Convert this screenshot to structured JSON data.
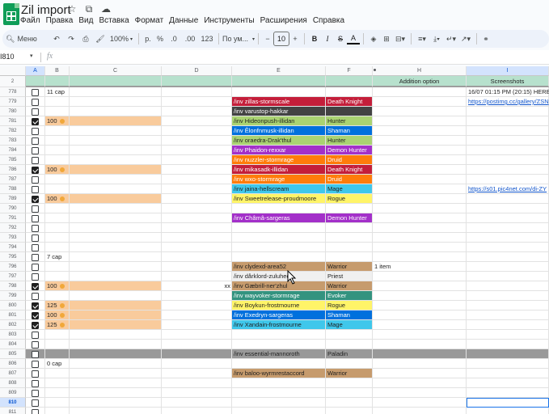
{
  "doc": {
    "title": "Zil import"
  },
  "title_icons": [
    "star-icon",
    "move-to-folder-icon",
    "cloud-status-icon"
  ],
  "menu": [
    "Файл",
    "Правка",
    "Вид",
    "Вставка",
    "Формат",
    "Данные",
    "Инструменты",
    "Расширения",
    "Справка"
  ],
  "toolbar": {
    "search_label": "Меню",
    "zoom": "100%",
    "currency": "р.",
    "percent": "%",
    "dec_decrease": ".0",
    "dec_increase": ".00",
    "number_format": "123",
    "font": "По ум...",
    "font_size": "10",
    "minus": "−",
    "plus": "+",
    "bold": "B",
    "italic": "I",
    "strike": "S",
    "text_color": "A"
  },
  "formula_bar": {
    "cell_ref": "I810",
    "fx": "fx"
  },
  "columns": [
    {
      "id": "A",
      "label": "A"
    },
    {
      "id": "B",
      "label": "B"
    },
    {
      "id": "C",
      "label": "C"
    },
    {
      "id": "D",
      "label": "D"
    },
    {
      "id": "E",
      "label": "E"
    },
    {
      "id": "F",
      "label": "F"
    },
    {
      "id": "H",
      "label": "H"
    },
    {
      "id": "I",
      "label": "I"
    }
  ],
  "header_row": {
    "rownum": "2",
    "H": "Addition option",
    "I": "Screenshots"
  },
  "colors": {
    "light_green_header": "#b7e1cd",
    "peach": "#f9cb9c",
    "gray_row": "#999999",
    "Death Knight": "#c41e3a",
    "Demon Hunter": "#a330c9",
    "Druid": "#ff7c0a",
    "Evoker": "#33937f",
    "Hunter": "#aad372",
    "Mage": "#3fc7eb",
    "Monk": "#00ff98",
    "Paladin": "#f48cba",
    "Priest": "#f0f0f0",
    "Rogue": "#fff468",
    "Shaman": "#0070dd",
    "Warlock": "#8788ee",
    "Warrior": "#c69b6d",
    "varustop": "#434343"
  },
  "rows": [
    {
      "n": "778",
      "checked": false,
      "B": "11 cap",
      "E": "",
      "F": "",
      "H": "",
      "I": "16/07 01:15 PM (20:15) HERE",
      "I_link": false,
      "peach": false,
      "cls": ""
    },
    {
      "n": "779",
      "checked": false,
      "B": "",
      "E": "/inv zillas-stormscale",
      "F": "Death Knight",
      "H": "",
      "I": "https://postimg.cc/gallery/ZSN",
      "I_link": true,
      "peach": false,
      "cls": "Death Knight"
    },
    {
      "n": "780",
      "checked": false,
      "B": "",
      "E": "/inv varustop-hakkar",
      "F": "",
      "H": "",
      "I": "",
      "I_link": false,
      "peach": false,
      "cls": "varustop"
    },
    {
      "n": "781",
      "checked": true,
      "B": "100",
      "gold": true,
      "E": "/inv Hideonpush-illidan",
      "F": "Hunter",
      "H": "",
      "I": "",
      "I_link": false,
      "peach": true,
      "cls": "Hunter"
    },
    {
      "n": "782",
      "checked": false,
      "B": "",
      "E": "/inv Êlonfnmusk-illidan",
      "F": "Shaman",
      "H": "",
      "I": "",
      "I_link": false,
      "peach": false,
      "cls": "Shaman"
    },
    {
      "n": "783",
      "checked": false,
      "B": "",
      "E": "/inv oraedra-Drak'thul",
      "F": "Hunter",
      "H": "",
      "I": "",
      "I_link": false,
      "peach": false,
      "cls": "Hunter"
    },
    {
      "n": "784",
      "checked": false,
      "B": "",
      "E": "/inv Phaidon-rexxar",
      "F": "Demon Hunter",
      "H": "",
      "I": "",
      "I_link": false,
      "peach": false,
      "cls": "Demon Hunter"
    },
    {
      "n": "785",
      "checked": false,
      "B": "",
      "E": "/inv nuzzler-stormrage",
      "F": "Druid",
      "H": "",
      "I": "",
      "I_link": false,
      "peach": false,
      "cls": "Druid"
    },
    {
      "n": "786",
      "checked": true,
      "B": "100",
      "gold": true,
      "E": "/inv mikasadk-illidan",
      "F": "Death Knight",
      "H": "",
      "I": "",
      "I_link": false,
      "peach": true,
      "cls": "Death Knight"
    },
    {
      "n": "787",
      "checked": false,
      "B": "",
      "E": "/inv wxo-stormrage",
      "F": "Druid",
      "H": "",
      "I": "",
      "I_link": false,
      "peach": false,
      "cls": "Druid"
    },
    {
      "n": "788",
      "checked": false,
      "B": "",
      "E": "/inv jaina-hellscream",
      "F": "Mage",
      "H": "",
      "I": "https://s01.pic4net.com/di-ZY",
      "I_link": true,
      "peach": false,
      "cls": "Mage"
    },
    {
      "n": "789",
      "checked": true,
      "B": "100",
      "gold": true,
      "E": "/inv Sweetrelease-proudmoore",
      "F": "Rogue",
      "H": "",
      "I": "",
      "I_link": false,
      "peach": true,
      "cls": "Rogue"
    },
    {
      "n": "790",
      "checked": false,
      "B": "",
      "E": "",
      "F": "",
      "H": "",
      "I": "",
      "I_link": false,
      "peach": false,
      "cls": ""
    },
    {
      "n": "791",
      "checked": false,
      "B": "",
      "E": "/inv Châmâ-sargeras",
      "F": "Demon Hunter",
      "H": "",
      "I": "",
      "I_link": false,
      "peach": false,
      "cls": "Demon Hunter"
    },
    {
      "n": "792",
      "checked": false,
      "B": "",
      "E": "",
      "F": "",
      "H": "",
      "I": "",
      "I_link": false,
      "peach": false,
      "cls": ""
    },
    {
      "n": "793",
      "checked": false,
      "B": "",
      "E": "",
      "F": "",
      "H": "",
      "I": "",
      "I_link": false,
      "peach": false,
      "cls": ""
    },
    {
      "n": "794",
      "checked": false,
      "B": "",
      "E": "",
      "F": "",
      "H": "",
      "I": "",
      "I_link": false,
      "peach": false,
      "cls": ""
    },
    {
      "n": "795",
      "checked": false,
      "B": "7 cap",
      "E": "",
      "F": "",
      "H": "",
      "I": "",
      "I_link": false,
      "peach": false,
      "cls": ""
    },
    {
      "n": "796",
      "checked": false,
      "B": "",
      "E": "/inv clydexd-area52",
      "F": "Warrior",
      "H": "1 item",
      "I": "",
      "I_link": false,
      "peach": false,
      "cls": "Warrior"
    },
    {
      "n": "797",
      "checked": false,
      "B": "",
      "E": "/inv dårklord-zuluhed",
      "F": "Priest",
      "H": "",
      "I": "",
      "I_link": false,
      "peach": false,
      "cls": "Priest"
    },
    {
      "n": "798",
      "checked": true,
      "B": "100",
      "gold": true,
      "D": "xx",
      "E": "/inv Gæbrill-ner'zhul",
      "F": "Warrior",
      "H": "",
      "I": "",
      "I_link": false,
      "peach": true,
      "cls": "Warrior"
    },
    {
      "n": "799",
      "checked": false,
      "B": "",
      "E": "/inv wayvoker-stormrage",
      "F": "Evoker",
      "H": "",
      "I": "",
      "I_link": false,
      "peach": false,
      "cls": "Evoker"
    },
    {
      "n": "800",
      "checked": true,
      "B": "125",
      "gold": true,
      "E": "/inv Boykun-frostmourne",
      "F": "Rogue",
      "H": "",
      "I": "",
      "I_link": false,
      "peach": true,
      "cls": "Rogue"
    },
    {
      "n": "801",
      "checked": true,
      "B": "100",
      "gold": true,
      "E": "/inv Exedryn-sargeras",
      "F": "Shaman",
      "H": "",
      "I": "",
      "I_link": false,
      "peach": true,
      "cls": "Shaman"
    },
    {
      "n": "802",
      "checked": true,
      "B": "125",
      "gold": true,
      "E": "/inv Xandain-frostmourne",
      "F": "Mage",
      "H": "",
      "I": "",
      "I_link": false,
      "peach": true,
      "cls": "Mage"
    },
    {
      "n": "803",
      "checked": false,
      "B": "",
      "E": "",
      "F": "",
      "H": "",
      "I": "",
      "I_link": false,
      "peach": false,
      "cls": ""
    },
    {
      "n": "804",
      "checked": false,
      "B": "",
      "E": "",
      "F": "",
      "H": "",
      "I": "",
      "I_link": false,
      "peach": false,
      "cls": ""
    },
    {
      "n": "805",
      "checked": false,
      "B": "",
      "E": "/inv essential-mannoroth",
      "F": "Paladin",
      "H": "",
      "I": "",
      "I_link": false,
      "peach": false,
      "cls": "",
      "gray": true
    },
    {
      "n": "806",
      "checked": false,
      "B": "0 cap",
      "E": "",
      "F": "",
      "H": "",
      "I": "",
      "I_link": false,
      "peach": false,
      "cls": ""
    },
    {
      "n": "807",
      "checked": false,
      "B": "",
      "E": "/inv baloo-wyrmrestaccord",
      "F": "Warrior",
      "H": "",
      "I": "",
      "I_link": false,
      "peach": false,
      "cls": "Warrior"
    },
    {
      "n": "808",
      "checked": false,
      "B": "",
      "E": "",
      "F": "",
      "H": "",
      "I": "",
      "I_link": false,
      "peach": false,
      "cls": ""
    },
    {
      "n": "809",
      "checked": false,
      "B": "",
      "E": "",
      "F": "",
      "H": "",
      "I": "",
      "I_link": false,
      "peach": false,
      "cls": ""
    },
    {
      "n": "810",
      "checked": false,
      "B": "",
      "E": "",
      "F": "",
      "H": "",
      "I": "",
      "I_link": false,
      "peach": false,
      "cls": "",
      "selected": true
    },
    {
      "n": "811",
      "checked": false,
      "B": "",
      "E": "",
      "F": "",
      "H": "",
      "I": "",
      "I_link": false,
      "peach": false,
      "cls": ""
    }
  ]
}
